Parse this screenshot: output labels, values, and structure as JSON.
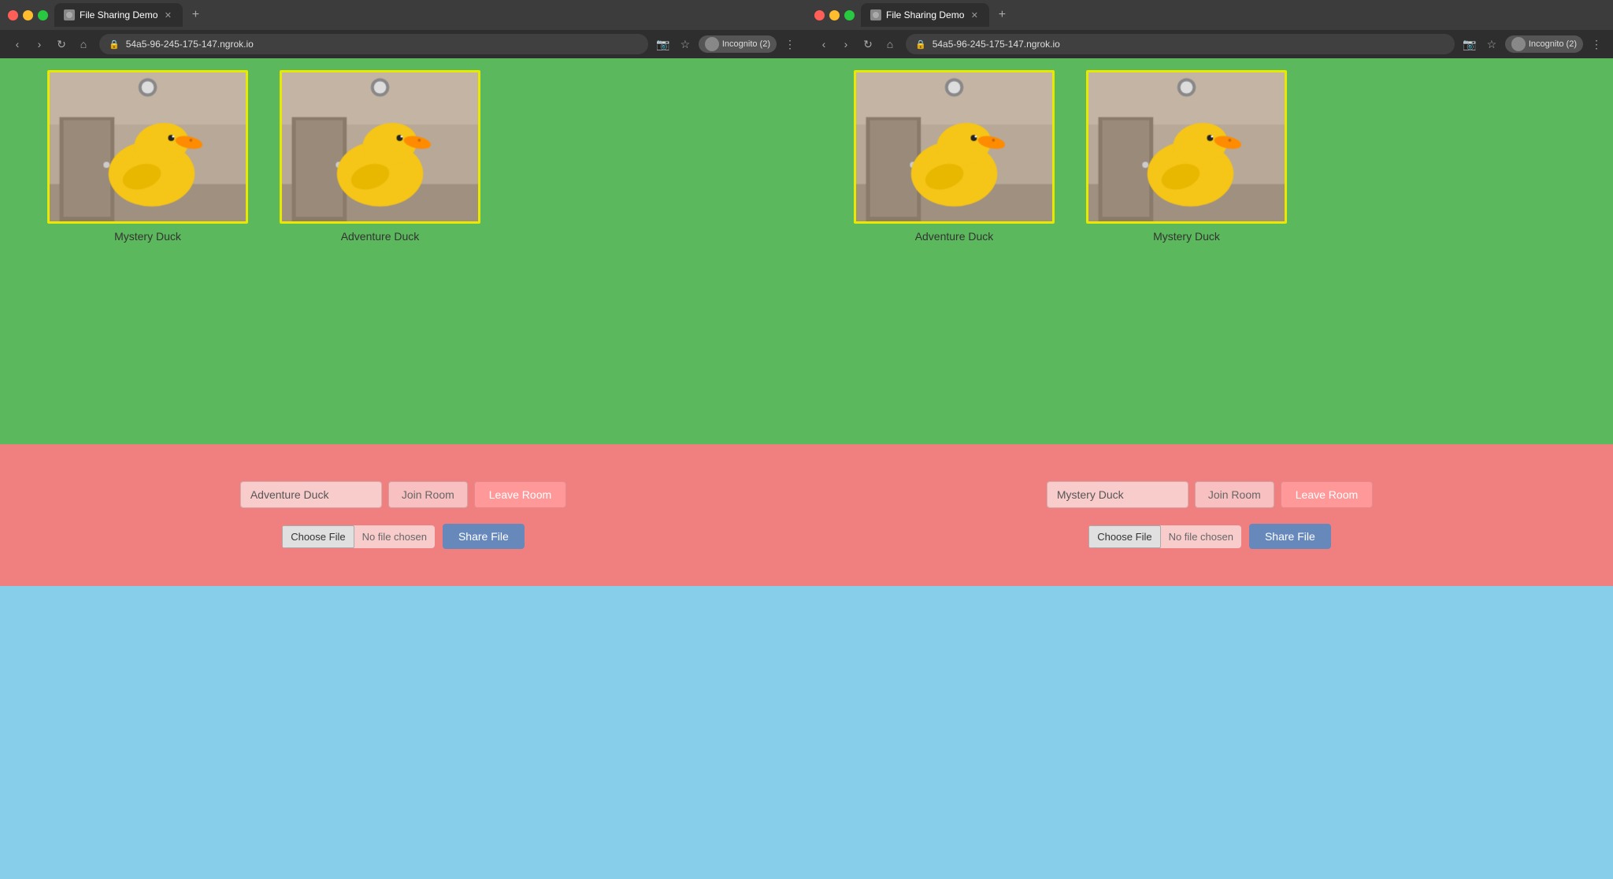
{
  "left_browser": {
    "tab_title": "File Sharing Demo",
    "url": "54a5-96-245-175-147.ngrok.io",
    "controls": {
      "room_input_value": "Adventure Duck",
      "join_label": "Join Room",
      "leave_label": "Leave Room",
      "choose_file_label": "Choose File",
      "no_file_text": "No file chosen",
      "share_label": "Share File"
    },
    "videos": [
      {
        "label": "Mystery Duck",
        "border_color": "#e8e800"
      },
      {
        "label": "Adventure Duck",
        "border_color": "#e8e800"
      }
    ],
    "incognito_text": "Incognito (2)"
  },
  "right_browser": {
    "tab_title": "File Sharing Demo",
    "url": "54a5-96-245-175-147.ngrok.io",
    "controls": {
      "room_input_value": "Mystery Duck",
      "join_label": "Join Room",
      "leave_label": "Leave Room",
      "choose_file_label": "Choose File",
      "no_file_text": "No file chosen",
      "share_label": "Share File"
    },
    "videos": [
      {
        "label": "Adventure Duck",
        "border_color": "#e8e800"
      },
      {
        "label": "Mystery Duck",
        "border_color": "#e8e800"
      }
    ],
    "incognito_text": "Incognito (2)"
  },
  "colors": {
    "green_bg": "#5cb85c",
    "pink_bg": "#f08080",
    "blue_bg": "#87ceeb",
    "share_btn": "#6688bb",
    "leave_btn": "#ff9999"
  }
}
